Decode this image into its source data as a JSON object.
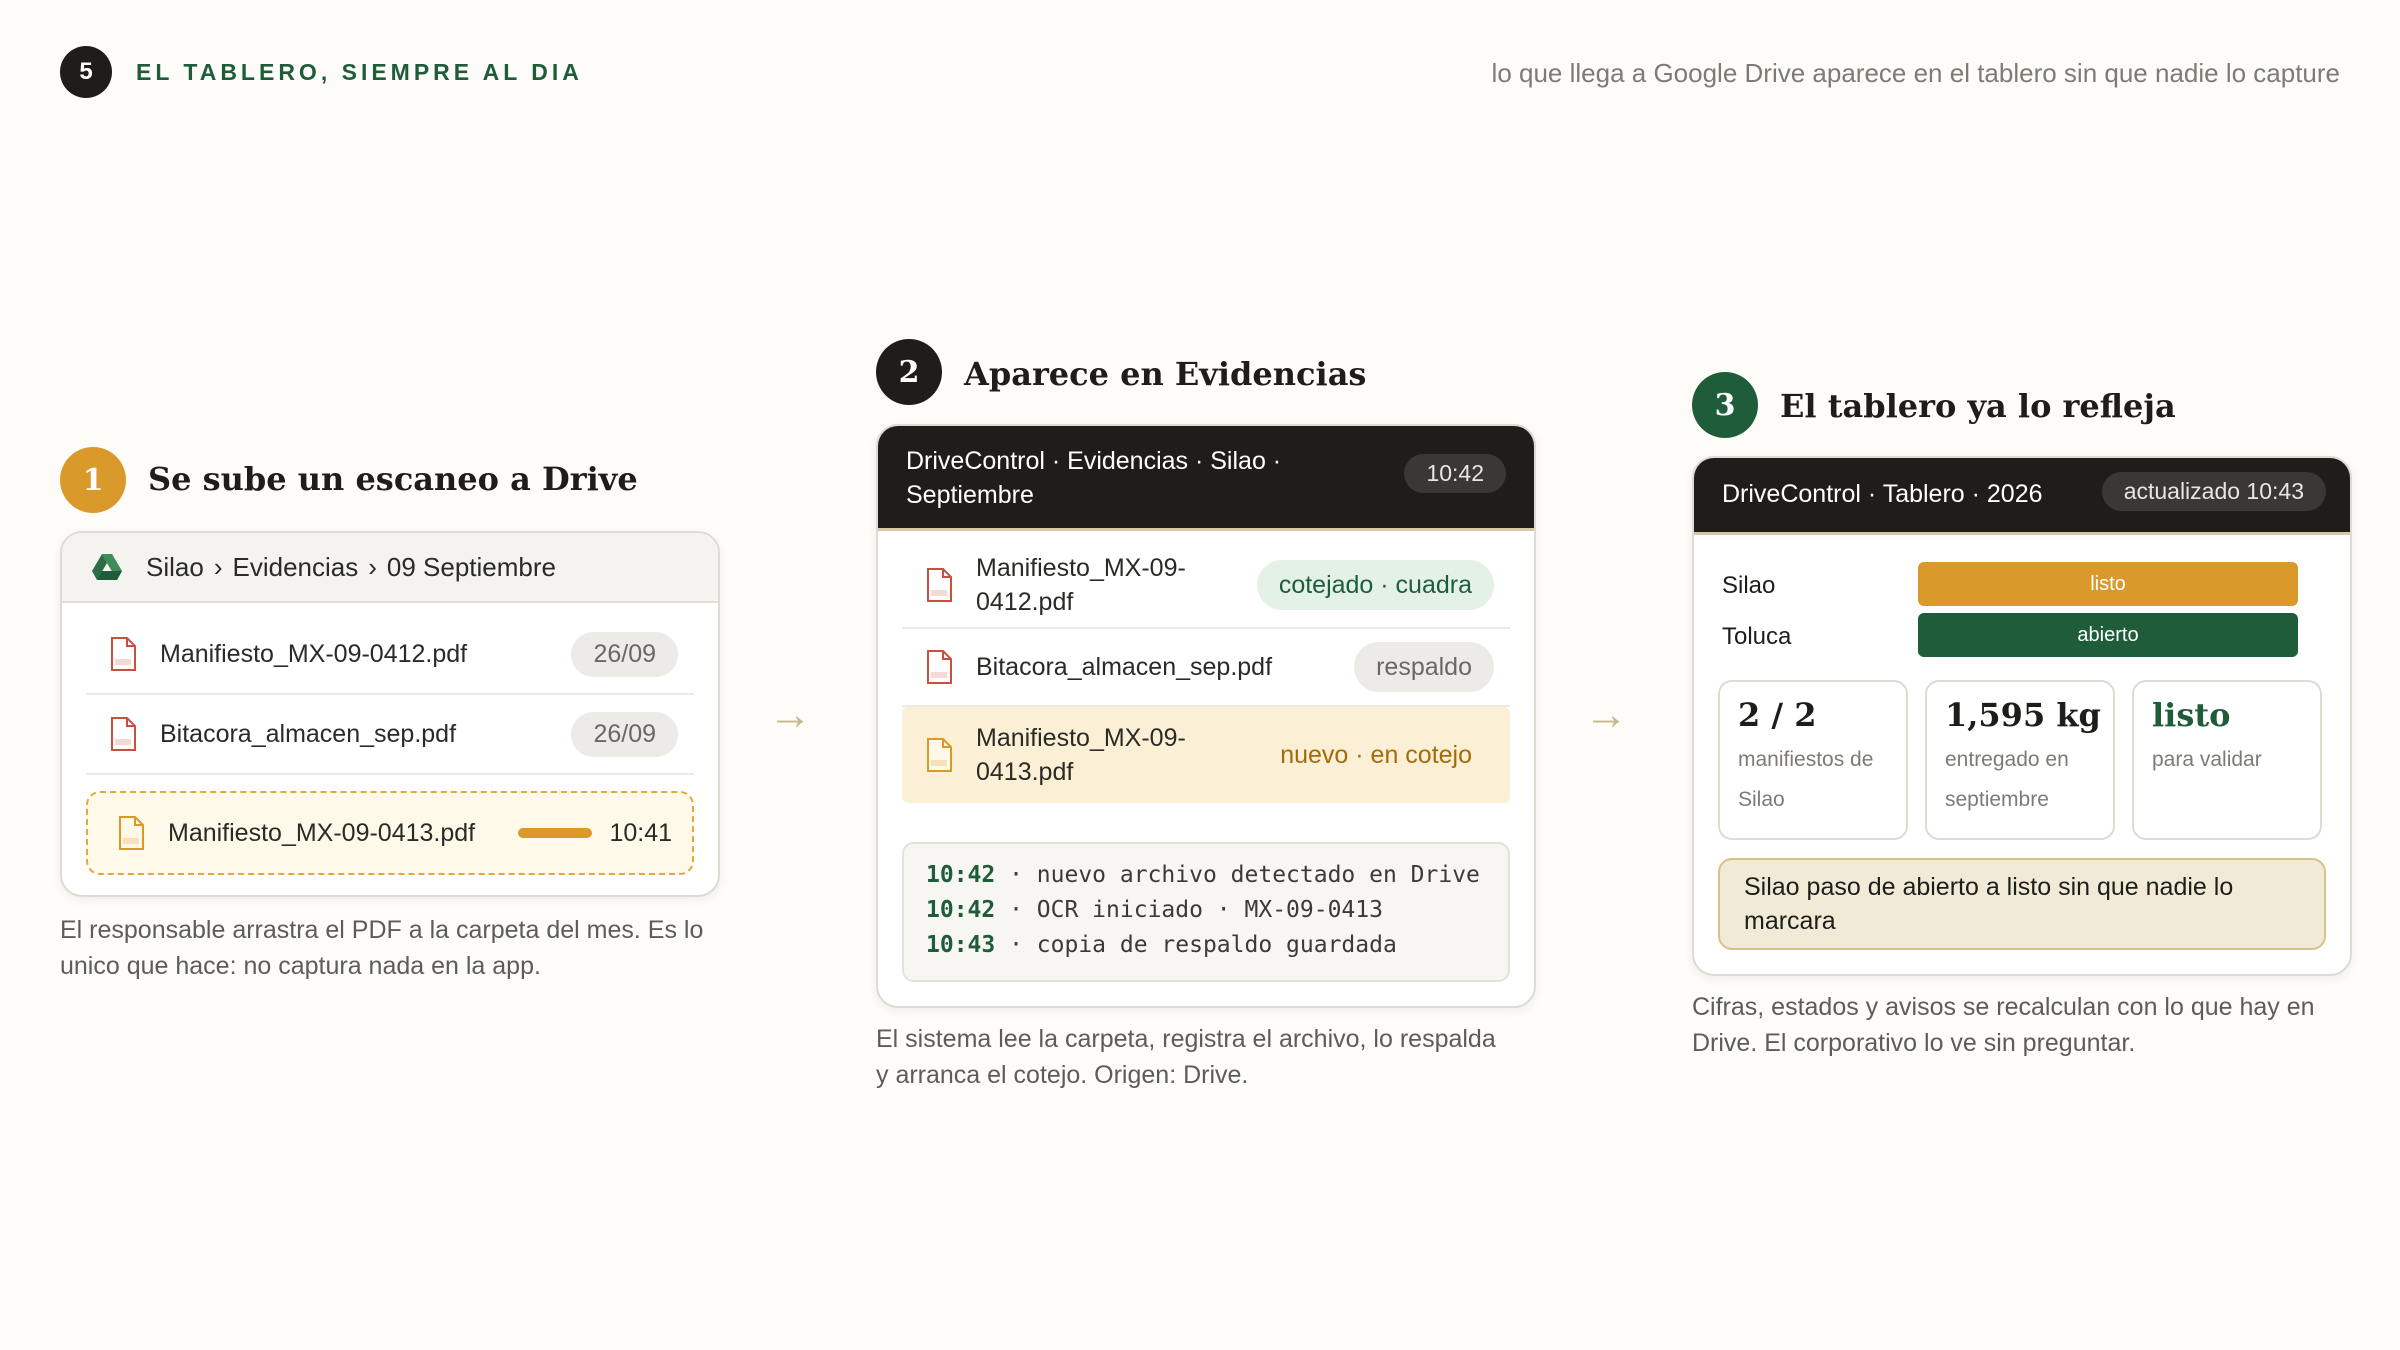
{
  "header": {
    "badge": "5",
    "title": "EL TABLERO, SIEMPRE AL DIA",
    "subtitle": "lo que llega a Google Drive aparece en el tablero sin que nadie lo capture"
  },
  "colors": {
    "amber": "#d99a2b",
    "green": "#1f5c3a",
    "dark": "#1f1d1a",
    "cream": "#fdfcf8"
  },
  "steps": {
    "s1": {
      "number": "1",
      "title": "Se sube un escaneo a Drive",
      "breadcrumb": {
        "icon": "google-drive-icon",
        "folder": "Silao",
        "sub": "Evidencias",
        "month": "09 Septiembre",
        "sep": "›"
      },
      "files": [
        {
          "name": "Manifiesto_MX-09-0412.pdf",
          "date": "26/09"
        },
        {
          "name": "Bitacora_almacen_sep.pdf",
          "date": "26/09"
        }
      ],
      "upload": {
        "name": "Manifiesto_MX-09-0413.pdf",
        "time": "10:41",
        "progress": 1.0
      },
      "caption_1": "El responsable arrastra el PDF a la carpeta del mes. Es lo",
      "caption_2": "unico que hace: no captura nada en la app."
    },
    "s2": {
      "number": "2",
      "title": "Aparece en Evidencias",
      "header_1": "DriveControl · Evidencias · Silao ·",
      "header_2": "Septiembre",
      "time": "10:42",
      "rows": [
        {
          "name_1": "Manifiesto_MX-09-",
          "name_2": "0412.pdf",
          "tag": "cotejado · cuadra"
        },
        {
          "name": "Bitacora_almacen_sep.pdf",
          "tag": "respaldo"
        },
        {
          "name_1": "Manifiesto_MX-09-",
          "name_2": "0413.pdf",
          "tag": "nuevo · en cotejo"
        }
      ],
      "log": [
        {
          "time": "10:42",
          "text": " · nuevo archivo detectado en Drive"
        },
        {
          "time": "10:42",
          "text": " · OCR iniciado · MX-09-0413"
        },
        {
          "time": "10:43",
          "text": " · copia de respaldo guardada"
        }
      ],
      "caption_1": "El sistema lee la carpeta, registra el archivo, lo respalda",
      "caption_2": "y arranca el cotejo. Origen: Drive."
    },
    "s3": {
      "number": "3",
      "title": "El tablero ya lo refleja",
      "header": "DriveControl · Tablero · 2026",
      "updated": "actualizado 10:43",
      "plants": [
        {
          "name": "Silao",
          "status": "listo"
        },
        {
          "name": "Toluca",
          "status": "abierto"
        }
      ],
      "stats": [
        {
          "value": "2 / 2",
          "label_1": "manifiestos de",
          "label_2": "Silao"
        },
        {
          "value": "1,595 kg",
          "label_1": "entregado en",
          "label_2": "septiembre"
        },
        {
          "value": "listo",
          "label_1": "para validar",
          "label_2": ""
        }
      ],
      "alert_1": "Silao paso de abierto a listo sin que nadie lo",
      "alert_2": "marcara",
      "caption_1": "Cifras, estados y avisos se recalculan con lo que hay en",
      "caption_2": "Drive. El corporativo lo ve sin preguntar."
    }
  }
}
